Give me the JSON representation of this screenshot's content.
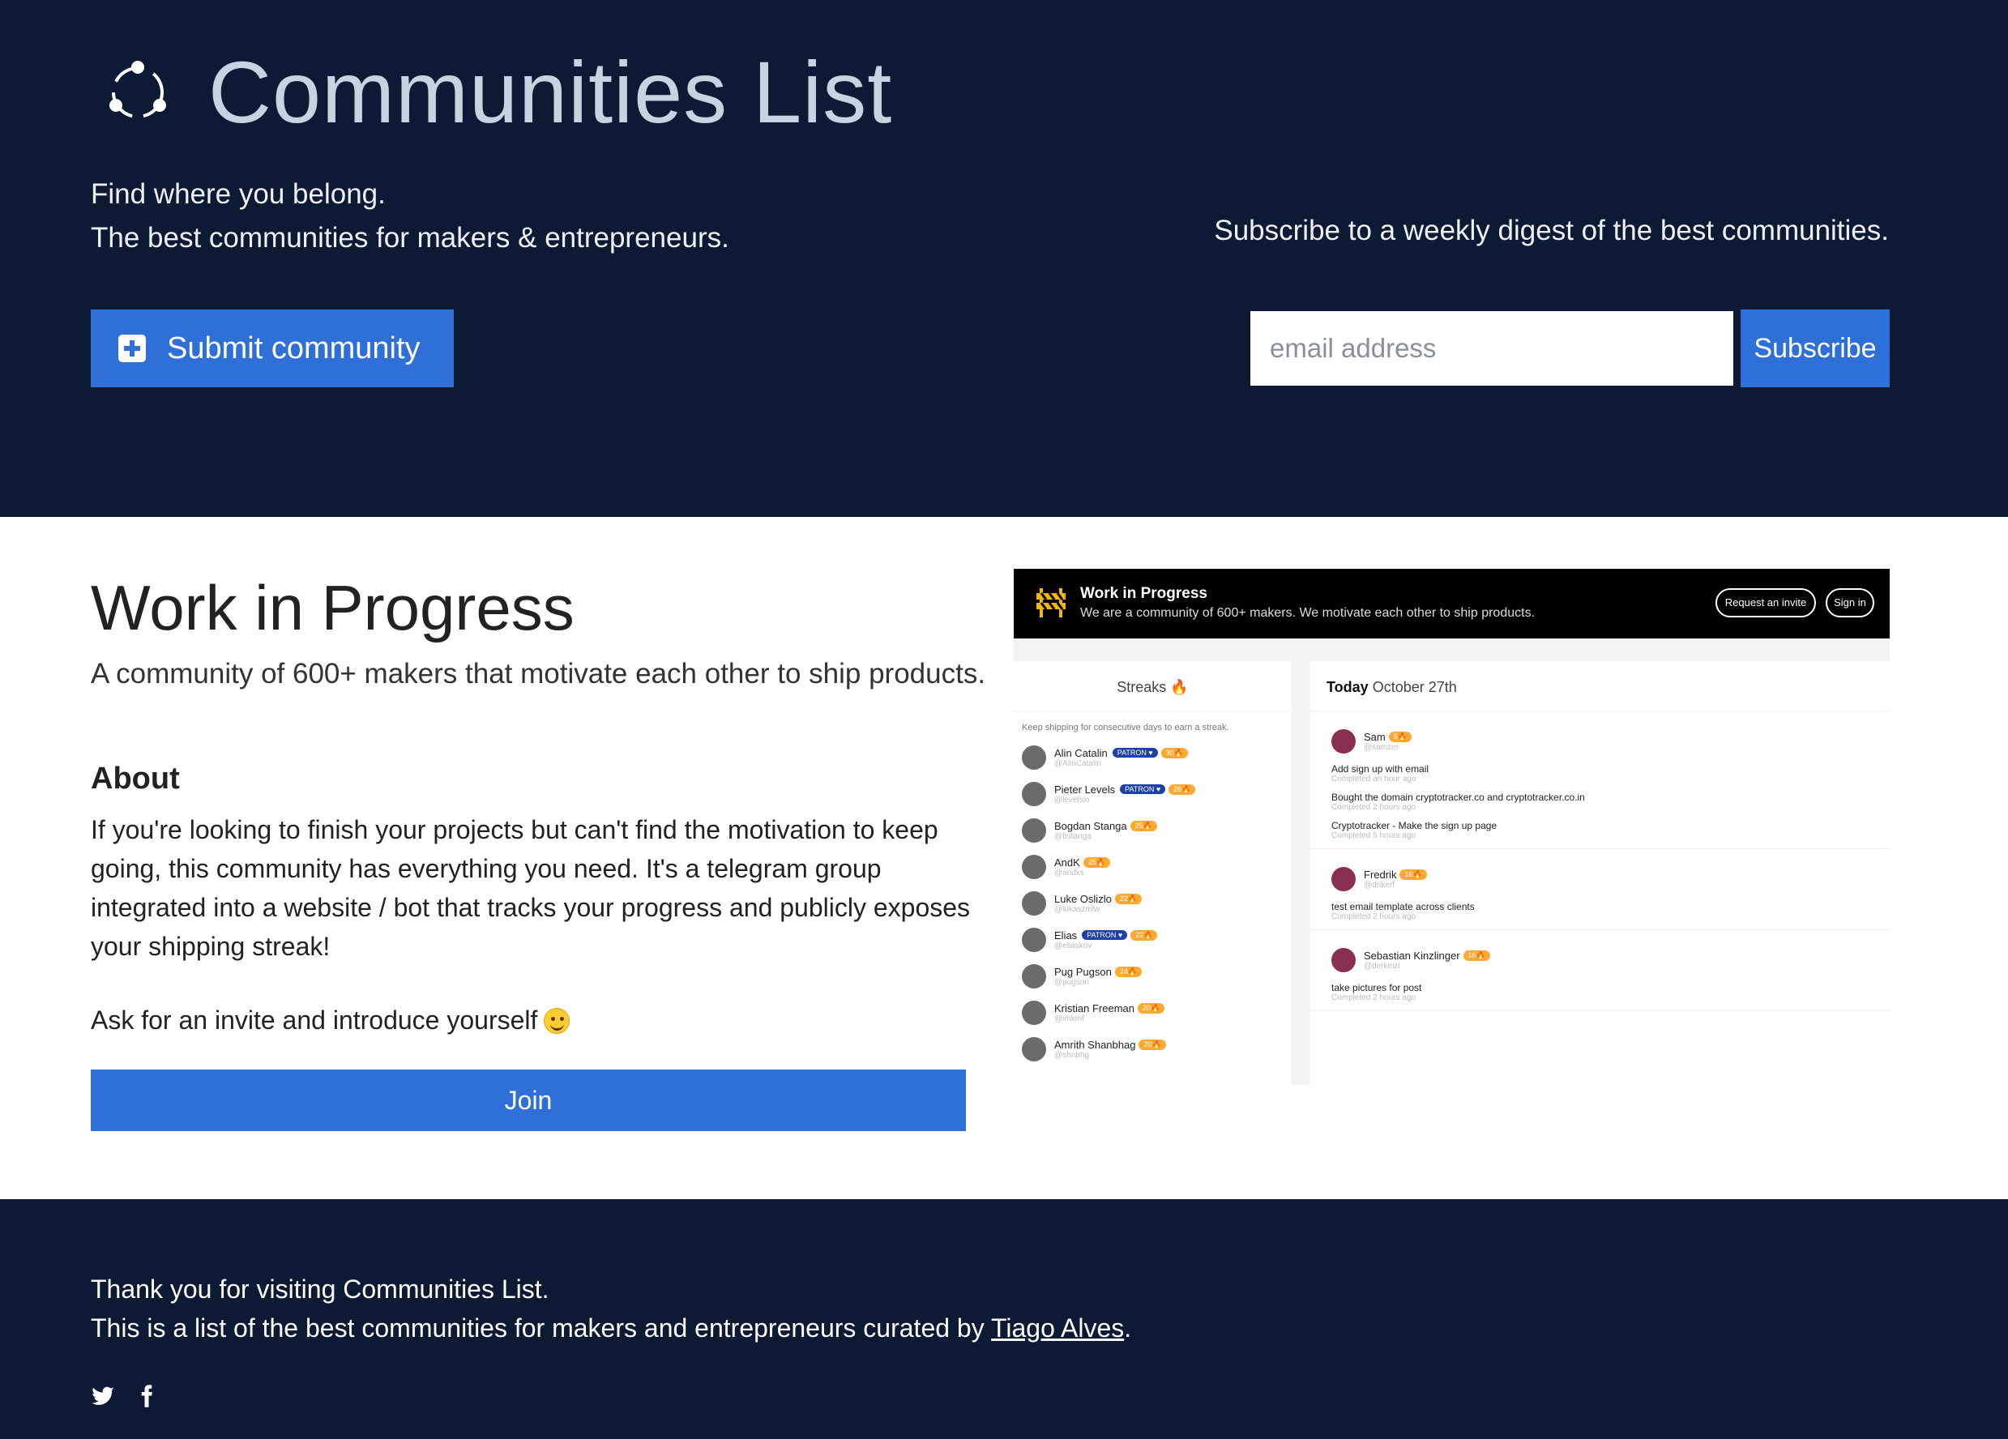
{
  "header": {
    "title": "Communities List",
    "logo_icon": "community-circle-icon",
    "tagline_line1": "Find where you belong.",
    "tagline_line2": "The best communities for makers & entrepreneurs.",
    "subscribe_text": "Subscribe to a weekly digest of the best communities.",
    "submit_label": "Submit community",
    "email_placeholder": "email address",
    "subscribe_label": "Subscribe"
  },
  "community": {
    "name": "Work in Progress",
    "description": "A community of 600+ makers that motivate each other to ship products.",
    "about_title": "About",
    "about_body": "If you're looking to finish your projects but can't find the motivation to keep going, this community has everything you need. It's a telegram group integrated into a website / bot that tracks your progress and publicly exposes your shipping streak!",
    "invite_text": "Ask for an invite and introduce yourself",
    "join_label": "Join"
  },
  "preview": {
    "title": "Work in Progress",
    "subtitle": "We are a community of 600+ makers. We motivate each other to ship products.",
    "request_invite": "Request an invite",
    "sign_in": "Sign in",
    "streaks_title": "Streaks 🔥",
    "streaks_note": "Keep shipping for consecutive days to earn a streak.",
    "streaks": [
      {
        "name": "Alin Catalin",
        "handle": "@AlinCatalin",
        "patron": "PATRON ♥",
        "streak": "30🔥"
      },
      {
        "name": "Pieter Levels",
        "handle": "@levelsio",
        "patron": "PATRON ♥",
        "streak": "26🔥"
      },
      {
        "name": "Bogdan Stanga",
        "handle": "@bstanga",
        "patron": "",
        "streak": "25🔥"
      },
      {
        "name": "AndK",
        "handle": "@andks",
        "patron": "",
        "streak": "25🔥"
      },
      {
        "name": "Luke Oslizlo",
        "handle": "@lukaszmlw",
        "patron": "",
        "streak": "22🔥"
      },
      {
        "name": "Elias",
        "handle": "@eliaskov",
        "patron": "PATRON ♥",
        "streak": "22🔥"
      },
      {
        "name": "Pug Pugson",
        "handle": "@pugson",
        "patron": "",
        "streak": "24🔥"
      },
      {
        "name": "Kristian Freeman",
        "handle": "@imkmf",
        "patron": "",
        "streak": "20🔥"
      },
      {
        "name": "Amrith Shanbhag",
        "handle": "@shnbhg",
        "patron": "",
        "streak": "20🔥"
      }
    ],
    "today_bold": "Today",
    "today_date": "October 27th",
    "feed": [
      {
        "name": "Sam",
        "handle": "@samzer",
        "streak": "5🔥",
        "tasks": [
          {
            "text": "Add sign up with email",
            "time": "Completed an hour ago"
          },
          {
            "text": "Bought the domain cryptotracker.co and cryptotracker.co.in",
            "time": "Completed 2 hours ago"
          },
          {
            "text": "Cryptotracker - Make the sign up page",
            "time": "Completed 5 hours ago"
          }
        ]
      },
      {
        "name": "Fredrik",
        "handle": "@drikerf",
        "streak": "16🔥",
        "tasks": [
          {
            "text": "test email template across clients",
            "time": "Completed 2 hours ago"
          }
        ]
      },
      {
        "name": "Sebastian Kinzlinger",
        "handle": "@derkinzi",
        "streak": "16🔥",
        "tasks": [
          {
            "text": "take pictures for post",
            "time": "Completed 2 hours ago"
          }
        ]
      }
    ]
  },
  "footer": {
    "line1": "Thank you for visiting Communities List.",
    "line2_prefix": "This is a list of the best communities for makers and entrepreneurs curated by ",
    "author": "Tiago Alves",
    "line2_suffix": ".",
    "icons": [
      "twitter-icon",
      "facebook-icon"
    ]
  },
  "colors": {
    "navy": "#0d1a33",
    "accent": "#2f6fd8",
    "title": "#c7d3e0"
  }
}
